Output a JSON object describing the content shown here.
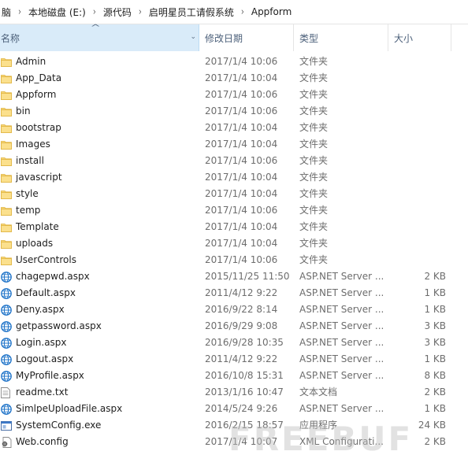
{
  "breadcrumb": [
    "脑",
    "本地磁盘 (E:)",
    "源代码",
    "启明星员工请假系统",
    "Appform"
  ],
  "columns": {
    "name": "名称",
    "date": "修改日期",
    "type": "类型",
    "size": "大小"
  },
  "files": [
    {
      "name": "Admin",
      "date": "2017/1/4 10:06",
      "type": "文件夹",
      "size": "",
      "icon": "folder-icon"
    },
    {
      "name": "App_Data",
      "date": "2017/1/4 10:04",
      "type": "文件夹",
      "size": "",
      "icon": "folder-icon"
    },
    {
      "name": "Appform",
      "date": "2017/1/4 10:06",
      "type": "文件夹",
      "size": "",
      "icon": "folder-icon"
    },
    {
      "name": "bin",
      "date": "2017/1/4 10:06",
      "type": "文件夹",
      "size": "",
      "icon": "folder-icon"
    },
    {
      "name": "bootstrap",
      "date": "2017/1/4 10:04",
      "type": "文件夹",
      "size": "",
      "icon": "folder-icon"
    },
    {
      "name": "Images",
      "date": "2017/1/4 10:04",
      "type": "文件夹",
      "size": "",
      "icon": "folder-icon"
    },
    {
      "name": "install",
      "date": "2017/1/4 10:06",
      "type": "文件夹",
      "size": "",
      "icon": "folder-icon"
    },
    {
      "name": "javascript",
      "date": "2017/1/4 10:04",
      "type": "文件夹",
      "size": "",
      "icon": "folder-icon"
    },
    {
      "name": "style",
      "date": "2017/1/4 10:04",
      "type": "文件夹",
      "size": "",
      "icon": "folder-icon"
    },
    {
      "name": "temp",
      "date": "2017/1/4 10:06",
      "type": "文件夹",
      "size": "",
      "icon": "folder-icon"
    },
    {
      "name": "Template",
      "date": "2017/1/4 10:04",
      "type": "文件夹",
      "size": "",
      "icon": "folder-icon"
    },
    {
      "name": "uploads",
      "date": "2017/1/4 10:04",
      "type": "文件夹",
      "size": "",
      "icon": "folder-icon"
    },
    {
      "name": "UserControls",
      "date": "2017/1/4 10:06",
      "type": "文件夹",
      "size": "",
      "icon": "folder-icon"
    },
    {
      "name": "chagepwd.aspx",
      "date": "2015/11/25 11:50",
      "type": "ASP.NET Server ...",
      "size": "2 KB",
      "icon": "aspx-globe-icon"
    },
    {
      "name": "Default.aspx",
      "date": "2011/4/12 9:22",
      "type": "ASP.NET Server ...",
      "size": "1 KB",
      "icon": "aspx-globe-icon"
    },
    {
      "name": "Deny.aspx",
      "date": "2016/9/22 8:14",
      "type": "ASP.NET Server ...",
      "size": "1 KB",
      "icon": "aspx-globe-icon"
    },
    {
      "name": "getpassword.aspx",
      "date": "2016/9/29 9:08",
      "type": "ASP.NET Server ...",
      "size": "3 KB",
      "icon": "aspx-globe-icon"
    },
    {
      "name": "Login.aspx",
      "date": "2016/9/28 10:35",
      "type": "ASP.NET Server ...",
      "size": "3 KB",
      "icon": "aspx-globe-icon"
    },
    {
      "name": "Logout.aspx",
      "date": "2011/4/12 9:22",
      "type": "ASP.NET Server ...",
      "size": "1 KB",
      "icon": "aspx-globe-icon"
    },
    {
      "name": "MyProfile.aspx",
      "date": "2016/10/8 15:31",
      "type": "ASP.NET Server ...",
      "size": "8 KB",
      "icon": "aspx-globe-icon"
    },
    {
      "name": "readme.txt",
      "date": "2013/1/16 10:47",
      "type": "文本文档",
      "size": "2 KB",
      "icon": "text-document-icon"
    },
    {
      "name": "SimlpeUploadFile.aspx",
      "date": "2014/5/24 9:26",
      "type": "ASP.NET Server ...",
      "size": "1 KB",
      "icon": "aspx-globe-icon"
    },
    {
      "name": "SystemConfig.exe",
      "date": "2016/2/15 18:57",
      "type": "应用程序",
      "size": "24 KB",
      "icon": "application-icon"
    },
    {
      "name": "Web.config",
      "date": "2017/1/4 10:07",
      "type": "XML Configurati...",
      "size": "2 KB",
      "icon": "config-gear-icon"
    }
  ],
  "watermark": "FREEBUF",
  "colors": {
    "folder": "#f8d775",
    "globe": "#1e73c8",
    "header_selected": "#d9ebf9",
    "header_text": "#4c607a"
  }
}
